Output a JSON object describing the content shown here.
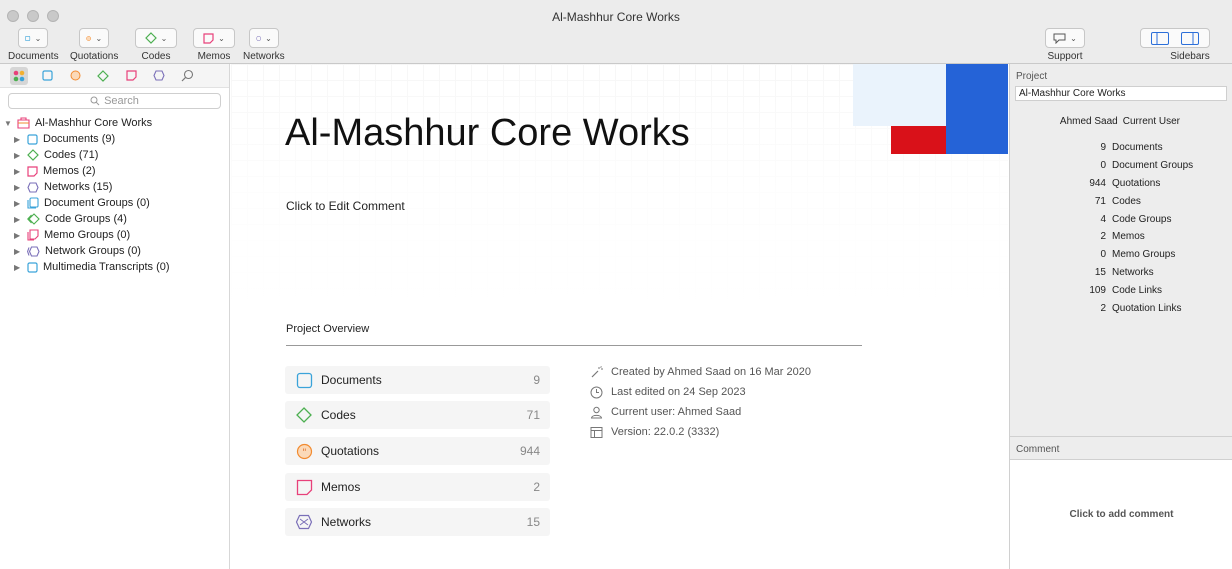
{
  "window": {
    "title": "Al-Mashhur Core Works"
  },
  "toolbar": {
    "documents": "Documents",
    "quotations": "Quotations",
    "codes": "Codes",
    "memos": "Memos",
    "networks": "Networks",
    "support": "Support",
    "sidebars": "Sidebars"
  },
  "left": {
    "search_placeholder": "Search",
    "root": "Al-Mashhur Core Works",
    "items": [
      {
        "label": "Documents (9)",
        "icon": "document-icon"
      },
      {
        "label": "Codes (71)",
        "icon": "code-icon"
      },
      {
        "label": "Memos (2)",
        "icon": "memo-icon"
      },
      {
        "label": "Networks (15)",
        "icon": "network-icon"
      },
      {
        "label": "Document Groups (0)",
        "icon": "document-group-icon"
      },
      {
        "label": "Code Groups (4)",
        "icon": "code-group-icon"
      },
      {
        "label": "Memo Groups (0)",
        "icon": "memo-group-icon"
      },
      {
        "label": "Network Groups (0)",
        "icon": "network-group-icon"
      },
      {
        "label": "Multimedia Transcripts (0)",
        "icon": "transcript-icon"
      }
    ]
  },
  "main": {
    "title": "Al-Mashhur Core Works",
    "comment_link": "Click to Edit Comment",
    "overview_heading": "Project Overview",
    "stats": [
      {
        "name": "Documents",
        "count": "9"
      },
      {
        "name": "Codes",
        "count": "71"
      },
      {
        "name": "Quotations",
        "count": "944"
      },
      {
        "name": "Memos",
        "count": "2"
      },
      {
        "name": "Networks",
        "count": "15"
      }
    ],
    "info": {
      "created": "Created by Ahmed Saad on 16 Mar 2020",
      "edited": "Last edited on 24 Sep 2023",
      "user": "Current user: Ahmed Saad",
      "version": "Version: 22.0.2 (3332)"
    }
  },
  "right": {
    "project_heading": "Project",
    "project_name": "Al-Mashhur Core Works",
    "user_name": "Ahmed Saad",
    "user_role": "Current User",
    "stats": [
      {
        "n": "9",
        "label": "Documents"
      },
      {
        "n": "0",
        "label": "Document Groups"
      },
      {
        "n": "944",
        "label": "Quotations"
      },
      {
        "n": "71",
        "label": "Codes"
      },
      {
        "n": "4",
        "label": "Code Groups"
      },
      {
        "n": "2",
        "label": "Memos"
      },
      {
        "n": "0",
        "label": "Memo Groups"
      },
      {
        "n": "15",
        "label": "Networks"
      },
      {
        "n": "109",
        "label": "Code Links"
      },
      {
        "n": "2",
        "label": "Quotation Links"
      }
    ],
    "comment_heading": "Comment",
    "comment_placeholder": "Click to add comment"
  },
  "colors": {
    "document": "#3aa3d9",
    "code": "#4caf50",
    "quotation": "#f28b30",
    "memo": "#e8407a",
    "network": "#7a6fb8",
    "accent_blue": "#2563d7",
    "accent_red": "#d91119"
  }
}
